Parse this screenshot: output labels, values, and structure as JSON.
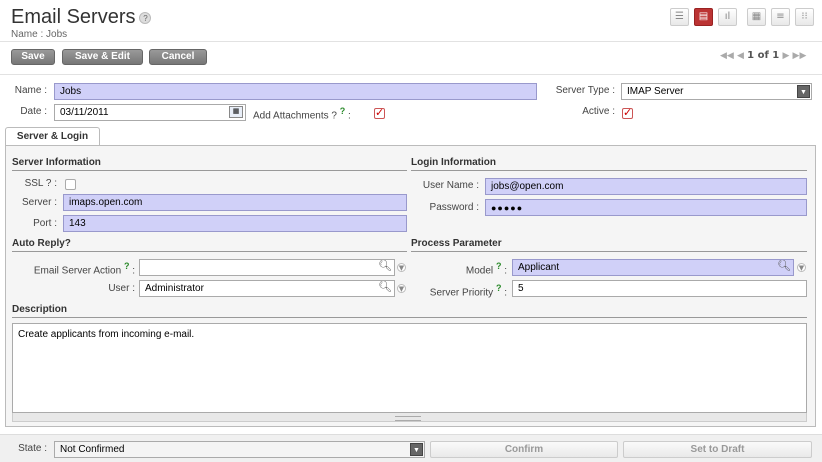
{
  "header": {
    "title": "Email Servers",
    "help": "?",
    "subtitle": "Name : Jobs"
  },
  "view_switch": [
    "list-view-icon",
    "form-view-icon",
    "graph-view-icon",
    "calendar-view-icon",
    "gantt-view-icon",
    "diagram-view-icon"
  ],
  "toolbar": {
    "save_label": "Save",
    "save_edit_label": "Save & Edit",
    "cancel_label": "Cancel"
  },
  "pager": {
    "first": "◀◀",
    "prev": "◀",
    "text": "1 of 1",
    "next": "▶",
    "last": "▶▶"
  },
  "form": {
    "name_label": "Name :",
    "name_value": "Jobs",
    "server_type_label": "Server Type :",
    "server_type_value": "IMAP Server",
    "date_label": "Date :",
    "date_value": "03/11/2011",
    "add_attachments_label": "Add Attachments ?",
    "add_attachments_suffix": ":",
    "add_attachments_checked": true,
    "active_label": "Active :",
    "active_checked": true
  },
  "tabs": [
    {
      "label": "Server & Login"
    }
  ],
  "server_info": {
    "heading": "Server Information",
    "ssl_label": "SSL ? :",
    "ssl_checked": false,
    "server_label": "Server :",
    "server_value": "imaps.open.com",
    "port_label": "Port :",
    "port_value": "143"
  },
  "login_info": {
    "heading": "Login Information",
    "username_label": "User Name :",
    "username_value": "jobs@open.com",
    "password_label": "Password :",
    "password_value": "●●●●●"
  },
  "auto_reply": {
    "heading": "Auto Reply?",
    "action_label": "Email Server Action",
    "action_suffix": ":",
    "action_value": "",
    "user_label": "User :",
    "user_value": "Administrator"
  },
  "process": {
    "heading": "Process Parameter",
    "model_label": "Model",
    "model_suffix": ":",
    "model_value": "Applicant",
    "priority_label": "Server Priority",
    "priority_suffix": ":",
    "priority_value": "5"
  },
  "description": {
    "heading": "Description",
    "value": "Create applicants from incoming e-mail."
  },
  "footer": {
    "state_label": "State :",
    "state_value": "Not Confirmed",
    "confirm_label": "Confirm",
    "draft_label": "Set to Draft"
  },
  "help_mark": "?",
  "colors": {
    "required_bg": "#d0d0f8",
    "accent": "#bb3333",
    "button_gray": "#888888"
  }
}
